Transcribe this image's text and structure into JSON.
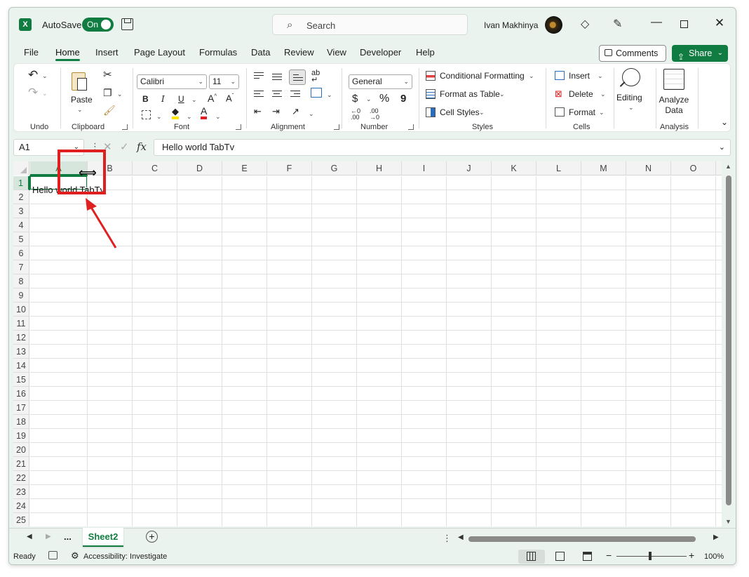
{
  "title_bar": {
    "autosave_label": "AutoSave",
    "autosave_state": "On",
    "search_placeholder": "Search",
    "user_name": "Ivan Makhinya",
    "window_controls": [
      "minimize",
      "maximize",
      "close"
    ]
  },
  "menu_tabs": [
    "File",
    "Home",
    "Insert",
    "Page Layout",
    "Formulas",
    "Data",
    "Review",
    "View",
    "Developer",
    "Help"
  ],
  "active_tab": "Home",
  "header_buttons": {
    "comments": "Comments",
    "share": "Share"
  },
  "ribbon": {
    "undo": {
      "group_label": "Undo"
    },
    "clipboard": {
      "paste_label": "Paste",
      "group_label": "Clipboard"
    },
    "font": {
      "font_name": "Calibri",
      "font_size": "11",
      "group_label": "Font",
      "bold": "B",
      "italic": "I",
      "underline": "U"
    },
    "alignment": {
      "group_label": "Alignment"
    },
    "number": {
      "format": "General",
      "group_label": "Number",
      "currency": "$",
      "percent": "%",
      "comma": "9"
    },
    "styles": {
      "conditional_formatting": "Conditional Formatting",
      "format_as_table": "Format as Table",
      "cell_styles": "Cell Styles",
      "group_label": "Styles"
    },
    "cells": {
      "insert": "Insert",
      "delete": "Delete",
      "format": "Format",
      "group_label": "Cells"
    },
    "editing": {
      "label": "Editing"
    },
    "analysis": {
      "analyze_data_line1": "Analyze",
      "analyze_data_line2": "Data",
      "group_label": "Analysis"
    }
  },
  "formula_bar": {
    "name_box": "A1",
    "fx": "fx",
    "formula": "Hello world TabTv"
  },
  "grid": {
    "columns": [
      "A",
      "B",
      "C",
      "D",
      "E",
      "F",
      "G",
      "H",
      "I",
      "J",
      "K",
      "L",
      "M",
      "N",
      "O"
    ],
    "rows": [
      "1",
      "2",
      "3",
      "4",
      "5",
      "6",
      "7",
      "8",
      "9",
      "10",
      "11",
      "12",
      "13",
      "14",
      "15",
      "16",
      "17",
      "18",
      "19",
      "20",
      "21",
      "22",
      "23",
      "24",
      "25"
    ],
    "selected_cell": "A1",
    "cell_a1_value": "Hello world TabTv"
  },
  "sheet_tabs": {
    "ellipsis": "...",
    "active_sheet": "Sheet2"
  },
  "status_bar": {
    "ready": "Ready",
    "accessibility": "Accessibility: Investigate",
    "zoom": "100%",
    "zoom_minus": "−",
    "zoom_plus": "+"
  },
  "colors": {
    "accent": "#107c41",
    "annotation": "#e02020"
  }
}
